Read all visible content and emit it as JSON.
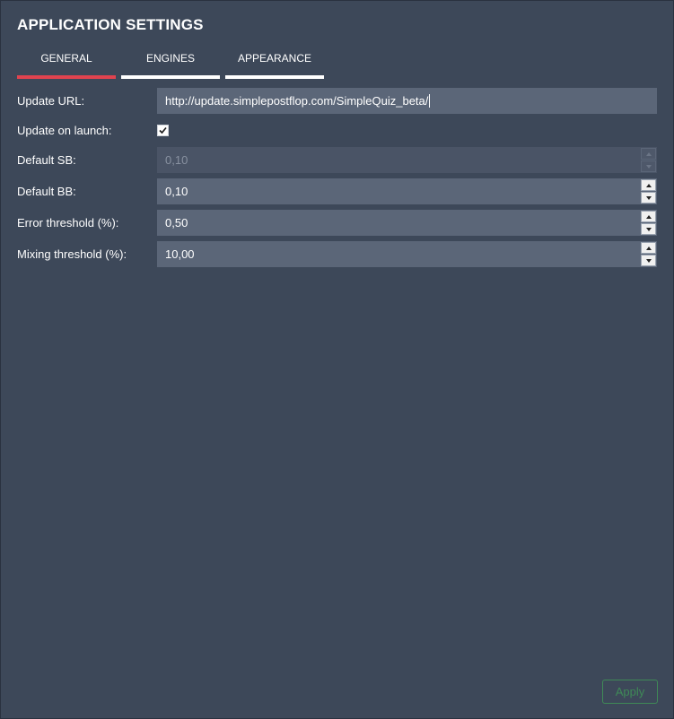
{
  "window": {
    "title": "APPLICATION SETTINGS"
  },
  "tabs": [
    {
      "label": "GENERAL",
      "active": true
    },
    {
      "label": "ENGINES",
      "active": false
    },
    {
      "label": "APPEARANCE",
      "active": false
    }
  ],
  "settings": {
    "update_url": {
      "label": "Update URL:",
      "value": "http://update.simplepostflop.com/SimpleQuiz_beta/"
    },
    "update_on_launch": {
      "label": "Update on launch:",
      "checked": true
    },
    "default_sb": {
      "label": "Default SB:",
      "value": "0,10",
      "enabled": false
    },
    "default_bb": {
      "label": "Default BB:",
      "value": "0,10"
    },
    "error_threshold": {
      "label": "Error threshold (%):",
      "value": "0,50"
    },
    "mixing_threshold": {
      "label": "Mixing threshold (%):",
      "value": "10,00"
    }
  },
  "footer": {
    "apply_label": "Apply"
  },
  "colors": {
    "background": "#3d4859",
    "field": "#5b6678",
    "active_tab": "#e0434f",
    "apply": "#3f8a57"
  },
  "icons": {
    "checkbox": "checkmark-icon",
    "spin_up": "arrow-up-icon",
    "spin_down": "arrow-down-icon"
  }
}
